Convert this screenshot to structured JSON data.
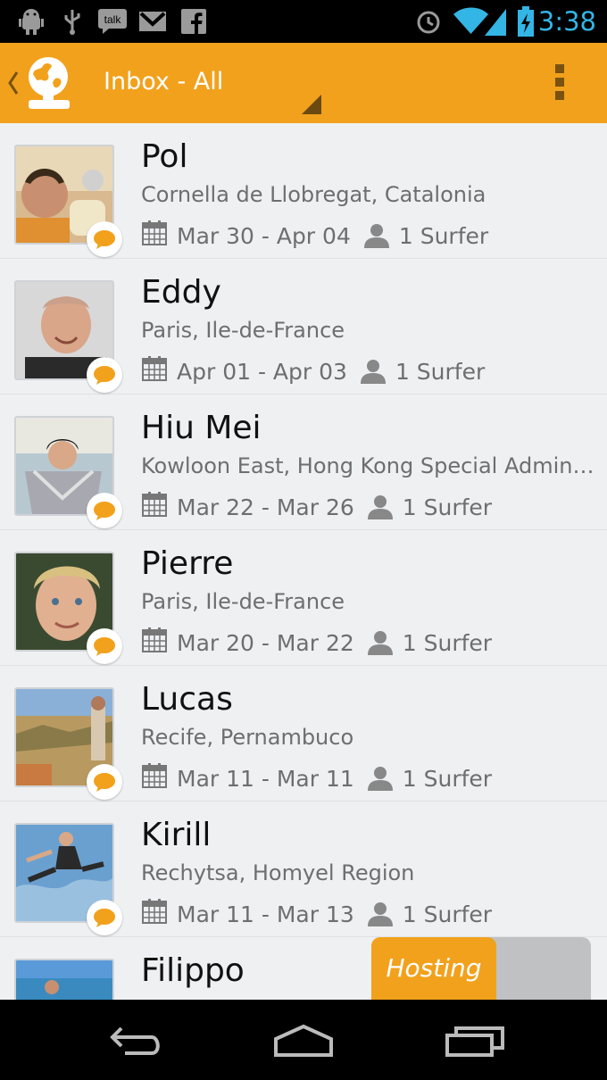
{
  "status_bar": {
    "time": "3:38",
    "notification_icons": [
      "android-debug-icon",
      "usb-icon",
      "talk-icon",
      "gmail-icon",
      "facebook-icon"
    ],
    "system_icons": [
      "alarm-icon",
      "wifi-icon",
      "signal-icon",
      "battery-charging-icon"
    ],
    "talk_label": "talk"
  },
  "action_bar": {
    "title": "Inbox - All",
    "colors": {
      "background": "#f2a11c",
      "title": "#ffffff"
    }
  },
  "inbox": [
    {
      "name": "Pol",
      "location": "Cornella de Llobregat, Catalonia",
      "dates": "Mar 30 - Apr 04",
      "surfers": "1 Surfer"
    },
    {
      "name": "Eddy",
      "location": "Paris, Ile-de-France",
      "dates": "Apr 01 - Apr 03",
      "surfers": "1 Surfer"
    },
    {
      "name": "Hiu Mei",
      "location": "Kowloon East, Hong Kong Special Administrative Region",
      "dates": "Mar 22 - Mar 26",
      "surfers": "1 Surfer"
    },
    {
      "name": "Pierre",
      "location": "Paris, Ile-de-France",
      "dates": "Mar 20 - Mar 22",
      "surfers": "1 Surfer"
    },
    {
      "name": "Lucas",
      "location": "Recife, Pernambuco",
      "dates": "Mar 11 - Mar 11",
      "surfers": "1 Surfer"
    },
    {
      "name": "Kirill",
      "location": "Rechytsa, Homyel Region",
      "dates": "Mar 11 - Mar 13",
      "surfers": "1 Surfer"
    },
    {
      "name": "Filippo"
    }
  ],
  "hosting_toggle": {
    "label": "Hosting",
    "state": "on"
  },
  "nav_bar": {
    "buttons": [
      "back-icon",
      "home-icon",
      "recent-apps-icon"
    ]
  },
  "colors": {
    "accent": "#f2a11c",
    "status_time": "#33b5e5",
    "list_background": "#eef0f2"
  }
}
